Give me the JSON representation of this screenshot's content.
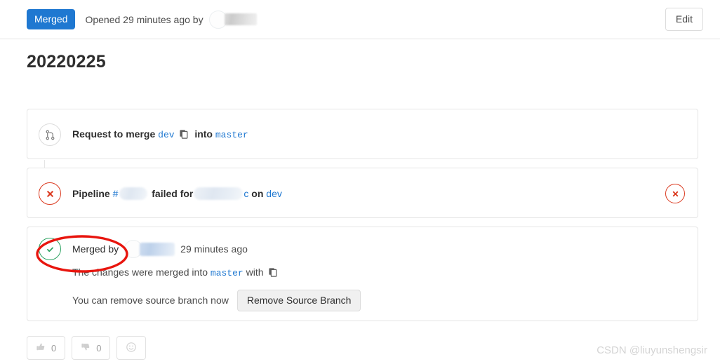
{
  "header": {
    "status_badge": "Merged",
    "opened_text": "Opened 29 minutes ago by",
    "author_redacted": "",
    "edit_label": "Edit"
  },
  "title": "20220225",
  "widgets": {
    "merge_request": {
      "icon": "merge-request-icon",
      "prefix": "Request to merge",
      "source_branch": "dev",
      "copy_icon": "copy-icon",
      "middle": "into",
      "target_branch": "master"
    },
    "pipeline": {
      "icon": "status-failed-icon",
      "prefix": "Pipeline",
      "hash_symbol": "#",
      "pipeline_id_redacted": "",
      "failed_text": "failed for",
      "commit_redacted": "",
      "commit_suffix": "c",
      "on_text": "on",
      "branch": "dev",
      "right_status_icon": "status-failed-icon"
    },
    "merged": {
      "icon": "status-success-icon",
      "merged_by_label": "Merged by",
      "merged_by_user_redacted": "",
      "timestamp": "29 minutes ago",
      "changes_prefix": "The changes were merged into",
      "target_branch": "master",
      "changes_suffix": "with",
      "copy_icon": "copy-icon",
      "remove_branch_note": "You can remove source branch now",
      "remove_branch_label": "Remove Source Branch",
      "annotation": "red-ellipse-highlight"
    }
  },
  "reactions": [
    {
      "name": "thumbsup-button",
      "icon": "thumbs-up-icon",
      "count": "0"
    },
    {
      "name": "thumbsdown-button",
      "icon": "thumbs-down-icon",
      "count": "0"
    },
    {
      "name": "add-reaction-button",
      "icon": "smiley-icon",
      "count": ""
    }
  ],
  "watermark": "CSDN @liuyunshengsir",
  "colors": {
    "badge_blue": "#1f78d1",
    "link_blue": "#1f78d1",
    "failed_red": "#db3b21",
    "success_green": "#2ba160",
    "annotation_red": "#e8150e"
  }
}
